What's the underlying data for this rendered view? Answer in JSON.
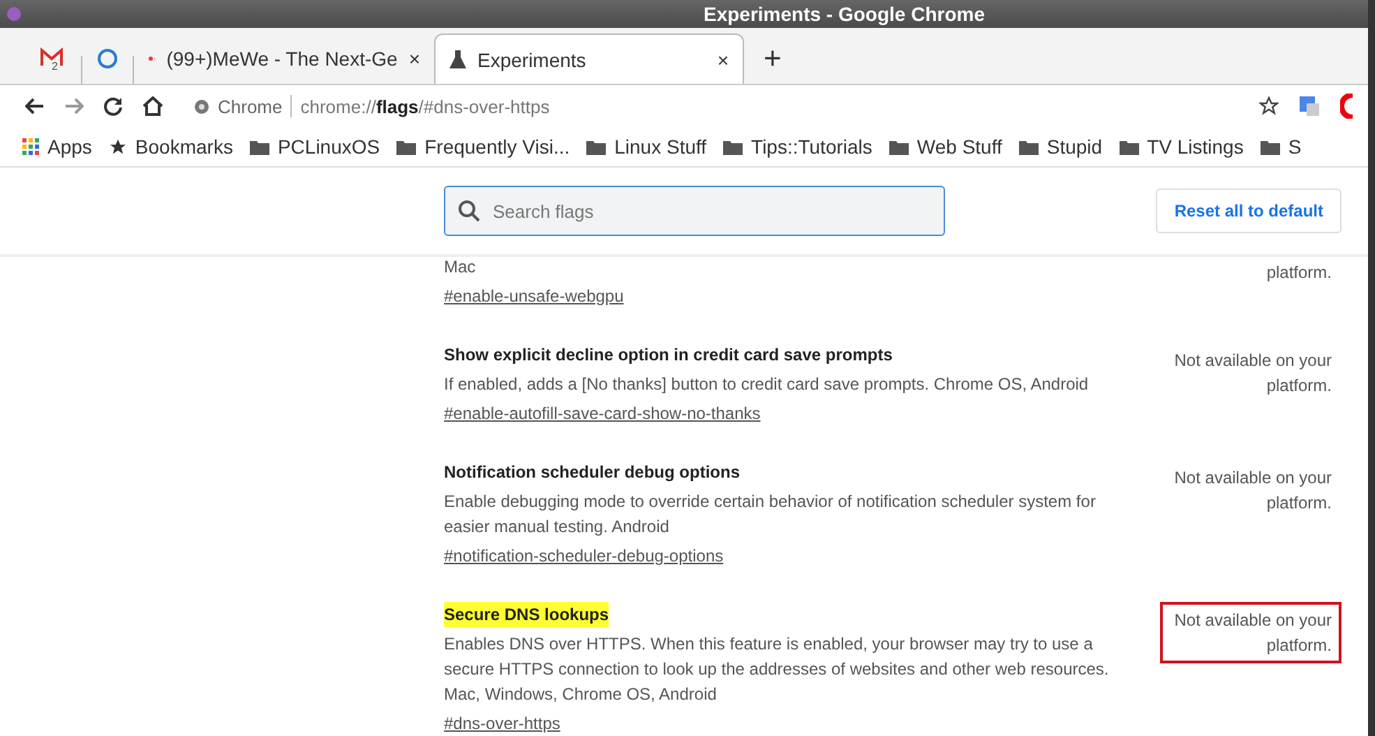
{
  "window": {
    "title": "Experiments - Google Chrome"
  },
  "tabs": [
    {
      "kind": "pinned",
      "label": "2",
      "selected": false
    },
    {
      "kind": "pinned",
      "selected": false
    },
    {
      "kind": "normal",
      "label": "(99+)MeWe - The Next-Ge",
      "close": "×",
      "selected": false
    },
    {
      "kind": "normal",
      "label": "Experiments",
      "close": "×",
      "selected": true
    }
  ],
  "new_tab": "+",
  "omnibox": {
    "site": "Chrome",
    "url_prefix": "chrome://",
    "url_bold": "flags",
    "url_rest": "/#dns-over-https"
  },
  "bookmarks": [
    {
      "kind": "apps",
      "label": "Apps"
    },
    {
      "kind": "star",
      "label": "Bookmarks"
    },
    {
      "kind": "folder",
      "label": "PCLinuxOS"
    },
    {
      "kind": "folder",
      "label": "Frequently Visi..."
    },
    {
      "kind": "folder",
      "label": "Linux Stuff"
    },
    {
      "kind": "folder",
      "label": "Tips::Tutorials"
    },
    {
      "kind": "folder",
      "label": "Web Stuff"
    },
    {
      "kind": "folder",
      "label": "Stupid"
    },
    {
      "kind": "folder",
      "label": "TV Listings"
    },
    {
      "kind": "folder",
      "label": "S"
    }
  ],
  "search": {
    "placeholder": "Search flags"
  },
  "reset_button": "Reset all to default",
  "flags": [
    {
      "description": "Mac",
      "link": "#enable-unsafe-webgpu",
      "status": "platform.",
      "outlined": false
    },
    {
      "title": "Show explicit decline option in credit card save prompts",
      "description": "If enabled, adds a [No thanks] button to credit card save prompts. Chrome OS, Android",
      "link": "#enable-autofill-save-card-show-no-thanks",
      "status": "Not available on your platform.",
      "highlighted": false,
      "outlined": false
    },
    {
      "title": "Notification scheduler debug options",
      "description": "Enable debugging mode to override certain behavior of notification scheduler system for easier manual testing. Android",
      "link": "#notification-scheduler-debug-options",
      "status": "Not available on your platform.",
      "highlighted": false,
      "outlined": false
    },
    {
      "title": "Secure DNS lookups",
      "description": "Enables DNS over HTTPS. When this feature is enabled, your browser may try to use a secure HTTPS connection to look up the addresses of websites and other web resources. Mac, Windows, Chrome OS, Android",
      "link": "#dns-over-https",
      "status": "Not available on your platform.",
      "highlighted": true,
      "outlined": true
    }
  ]
}
